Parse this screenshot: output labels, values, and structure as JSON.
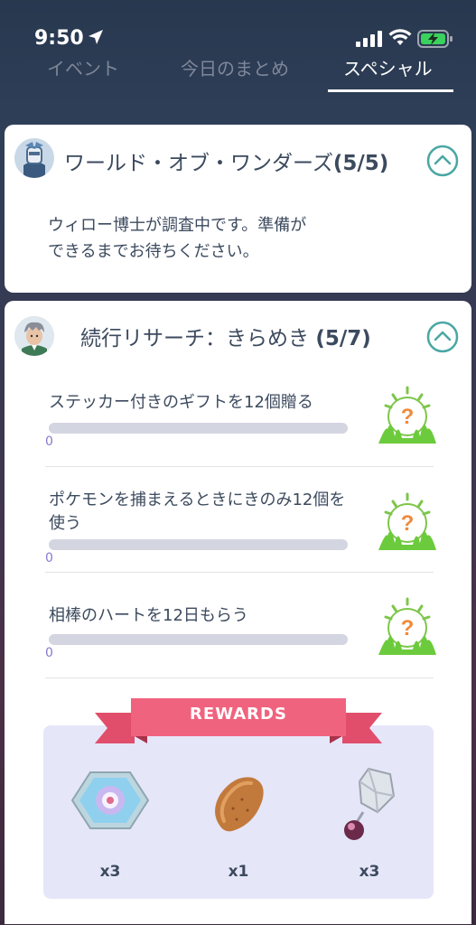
{
  "status": {
    "time": "9:50"
  },
  "tabs": [
    {
      "label": "イベント"
    },
    {
      "label": "今日のまとめ"
    },
    {
      "label": "スペシャル"
    }
  ],
  "card1": {
    "title": "ワールド・オブ・ワンダーズ",
    "progress": "(5/5)",
    "description": "ウィロー博士が調査中です。準備が\nできるまでお待ちください。"
  },
  "card2": {
    "title": "続行リサーチ：きらめき ",
    "progress": "(5/7)",
    "tasks": [
      {
        "text": "ステッカー付きのギフトを12個贈る",
        "count": "0",
        "progress": 0
      },
      {
        "text": "ポケモンを捕まえるときにきのみ12個を使う",
        "count": "0",
        "progress": 0
      },
      {
        "text": "相棒のハートを12日もらう",
        "count": "0",
        "progress": 0
      }
    ],
    "rewards_label": "REWARDS",
    "rewards": [
      {
        "icon": "lure-module-icon",
        "qty": "x3"
      },
      {
        "icon": "berry-icon",
        "qty": "x1"
      },
      {
        "icon": "evolution-item-icon",
        "qty": "x3"
      }
    ]
  },
  "colors": {
    "accent_pink": "#f0637e",
    "text": "#3c4a5e",
    "teal": "#4aa7a3",
    "progress_track": "#d3d5e1",
    "reward_bg": "#e6e6f9"
  }
}
